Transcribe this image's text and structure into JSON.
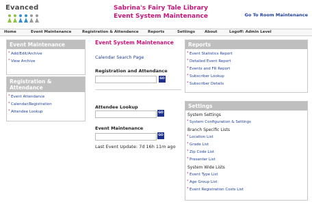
{
  "header": {
    "logo_text": "Evanced",
    "title_line1": "Sabrina's Fairy Tale Library",
    "title_line2": "Event System Maintenance",
    "goto_link": "Go To Room Maintenance",
    "brand_color": "#c8147a",
    "link_color": "#1f3fa0"
  },
  "nav": [
    "Home",
    "Event Maintenance",
    "Registration & Attendance",
    "Reports",
    "Settings",
    "About",
    "Logoff: Admin Level"
  ],
  "left": {
    "event_maintenance": {
      "title": "Event Maintenance",
      "items": [
        "Add/Edit/Archive",
        "View Archive"
      ]
    },
    "registration": {
      "title_line1": "Registration &",
      "title_line2": "Attendance",
      "items": [
        "Event Attendance",
        "Calendar/Registration",
        "Attendee Lookup"
      ]
    }
  },
  "center": {
    "title": "Event System Maintenance",
    "calendar_link": "Calendar Search Page",
    "reg_label": "Registration and Attendance",
    "attendee_label": "Attendee Lookup",
    "event_label": "Event Maintenance",
    "go_label": "GO",
    "last_update": "Last Event Update: 7d 16h 11m ago"
  },
  "right": {
    "reports": {
      "title": "Reports",
      "items": [
        "Event Statistics Report",
        "Detailed Event Report",
        "Events and FR Report",
        "Subscriber Lookup",
        "Subscriber Details"
      ]
    },
    "settings": {
      "title": "Settings",
      "system_heading": "System Settings",
      "system_items": [
        "System Configuration & Settings"
      ],
      "branch_heading": "Branch Specific Lists",
      "branch_items": [
        "Location List",
        "Grade List",
        "Zip Code List",
        "Presenter List"
      ],
      "wide_heading": "System Wide Lists",
      "wide_items": [
        "Event Type List",
        "Age Group List",
        "Event Registration Costs List"
      ]
    }
  }
}
